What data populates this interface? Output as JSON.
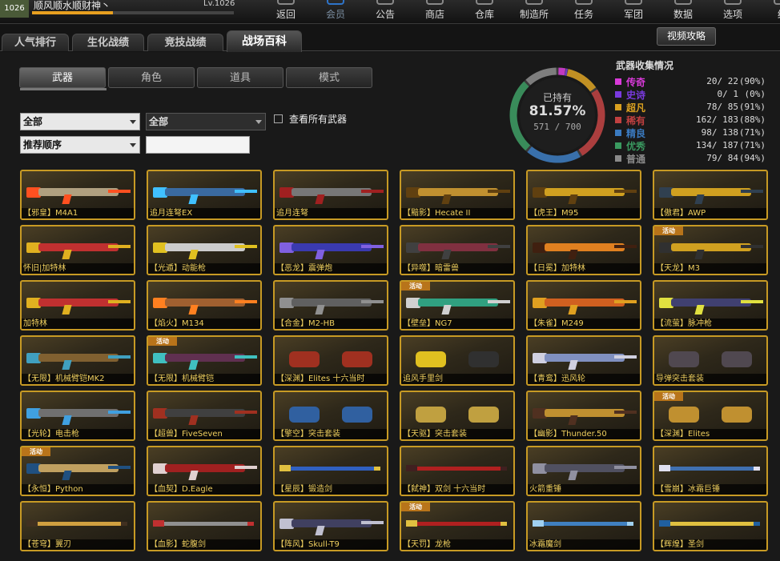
{
  "player": {
    "level_badge": "1026",
    "name": "顺风顺水顺财神丶",
    "level_text": "Lv.1026",
    "exp_fraction": 0.4
  },
  "menu": [
    {
      "label": "返回",
      "icon": "back-arrow-icon"
    },
    {
      "label": "会员",
      "icon": "vip-icon",
      "active": true
    },
    {
      "label": "公告",
      "icon": "megaphone-icon"
    },
    {
      "label": "商店",
      "icon": "shop-icon"
    },
    {
      "label": "仓库",
      "icon": "warehouse-icon"
    },
    {
      "label": "制造所",
      "icon": "factory-icon"
    },
    {
      "label": "任务",
      "icon": "task-icon"
    },
    {
      "label": "军团",
      "icon": "clan-icon"
    },
    {
      "label": "数据",
      "icon": "data-icon"
    },
    {
      "label": "选项",
      "icon": "options-icon"
    },
    {
      "label": "结",
      "icon": "exit-icon"
    }
  ],
  "tabs": [
    {
      "label": "人气排行"
    },
    {
      "label": "生化战绩"
    },
    {
      "label": "竞技战绩"
    },
    {
      "label": "战场百科",
      "active": true
    }
  ],
  "video_button": "视频攻略",
  "subtabs": [
    {
      "label": "武器",
      "active": true
    },
    {
      "label": "角色"
    },
    {
      "label": "道具"
    },
    {
      "label": "模式"
    }
  ],
  "filters": {
    "category": "全部",
    "subcategory": "全部",
    "sort": "推荐顺序",
    "search_value": "",
    "show_all_label": "查看所有武器",
    "show_all_checked": false
  },
  "collection": {
    "title": "武器收集情况",
    "owned_label": "已持有",
    "percent": "81.57%",
    "ratio": "571 / 700",
    "rows": [
      {
        "name": "传奇",
        "count": "20/  22",
        "pct": "(90%)",
        "color": "#d93ad9",
        "owned": 20,
        "total": 22
      },
      {
        "name": "史诗",
        "count": "0/   1",
        "pct": "(0%)",
        "color": "#7a3ae0",
        "owned": 0,
        "total": 1
      },
      {
        "name": "超凡",
        "count": "78/  85",
        "pct": "(91%)",
        "color": "#d9a020",
        "owned": 78,
        "total": 85
      },
      {
        "name": "稀有",
        "count": "162/ 183",
        "pct": "(88%)",
        "color": "#c04040",
        "owned": 162,
        "total": 183
      },
      {
        "name": "精良",
        "count": "98/ 138",
        "pct": "(71%)",
        "color": "#3a7ac0",
        "owned": 98,
        "total": 138
      },
      {
        "name": "优秀",
        "count": "134/ 187",
        "pct": "(71%)",
        "color": "#3a9a60",
        "owned": 134,
        "total": 187
      },
      {
        "name": "普通",
        "count": "79/  84",
        "pct": "(94%)",
        "color": "#8a8a8a",
        "owned": 79,
        "total": 84
      }
    ]
  },
  "weapons": [
    {
      "label": "【邪皇】M4A1",
      "kind": "rifle",
      "c1": "#b0a080",
      "c2": "#ff5020"
    },
    {
      "label": "追月连弩EX",
      "kind": "rifle",
      "c1": "#3a6aa0",
      "c2": "#40c0ff"
    },
    {
      "label": "追月连弩",
      "kind": "rifle",
      "c1": "#777777",
      "c2": "#a02020"
    },
    {
      "label": "【黯影】Hecate II",
      "kind": "rifle",
      "c1": "#c09030",
      "c2": "#604010"
    },
    {
      "label": "【虎王】M95",
      "kind": "rifle",
      "c1": "#d0a020",
      "c2": "#604010"
    },
    {
      "label": "【傲君】AWP",
      "kind": "rifle",
      "c1": "#d0a020",
      "c2": "#304050"
    },
    {
      "label": "怀旧|加特林",
      "kind": "heavy",
      "c1": "#c03030",
      "c2": "#e0b020"
    },
    {
      "label": "【光遁】动能枪",
      "kind": "rifle",
      "c1": "#cccccc",
      "c2": "#e0c020"
    },
    {
      "label": "【恶龙】震弹炮",
      "kind": "heavy",
      "c1": "#3a3ab0",
      "c2": "#8060e0"
    },
    {
      "label": "【异噬】暗雷兽",
      "kind": "heavy",
      "c1": "#803040",
      "c2": "#404040"
    },
    {
      "label": "【日冕】加特林",
      "kind": "heavy",
      "c1": "#e08020",
      "c2": "#402010"
    },
    {
      "label": "【天龙】M3",
      "kind": "rifle",
      "c1": "#d0a020",
      "c2": "#303030",
      "badge": "活动"
    },
    {
      "label": "加特林",
      "kind": "heavy",
      "c1": "#c03030",
      "c2": "#e0b020"
    },
    {
      "label": "【焰火】M134",
      "kind": "heavy",
      "c1": "#a06030",
      "c2": "#ff8020"
    },
    {
      "label": "【合金】M2-HB",
      "kind": "rifle",
      "c1": "#606060",
      "c2": "#909090"
    },
    {
      "label": "【壁垒】NG7",
      "kind": "rifle",
      "c1": "#30a080",
      "c2": "#d0d0d0",
      "badge": "活动"
    },
    {
      "label": "【朱雀】M249",
      "kind": "heavy",
      "c1": "#d06020",
      "c2": "#e0a020"
    },
    {
      "label": "【流萤】脉冲枪",
      "kind": "rifle",
      "c1": "#404070",
      "c2": "#e0e040"
    },
    {
      "label": "【无限】机械臂铠MK2",
      "kind": "heavy",
      "c1": "#806030",
      "c2": "#40a0c0"
    },
    {
      "label": "【无限】机械臂铠",
      "kind": "heavy",
      "c1": "#603050",
      "c2": "#40c0c0",
      "badge": "活动"
    },
    {
      "label": "【深渊】Elites 十六当时",
      "kind": "pair",
      "c1": "#a03020",
      "c2": "#a03020"
    },
    {
      "label": "追风手里剑",
      "kind": "pair",
      "c1": "#e0c020",
      "c2": "#303030"
    },
    {
      "label": "【青鸾】迅风轮",
      "kind": "heavy",
      "c1": "#8090c0",
      "c2": "#d0d0e0"
    },
    {
      "label": "导弹突击套装",
      "kind": "pair",
      "c1": "#504850",
      "c2": "#504850"
    },
    {
      "label": "【光轮】电击枪",
      "kind": "pistol",
      "c1": "#707070",
      "c2": "#40a0e0"
    },
    {
      "label": "【超兽】FiveSeven",
      "kind": "pistol",
      "c1": "#404040",
      "c2": "#a03020"
    },
    {
      "label": "【擎空】突击套装",
      "kind": "pair",
      "c1": "#3060a0",
      "c2": "#3060a0"
    },
    {
      "label": "【天驱】突击套装",
      "kind": "pair",
      "c1": "#c0a040",
      "c2": "#c0a040"
    },
    {
      "label": "【幽影】Thunder.50",
      "kind": "rifle",
      "c1": "#c09030",
      "c2": "#503020"
    },
    {
      "label": "【深渊】Elites",
      "kind": "pair",
      "c1": "#c09030",
      "c2": "#c09030",
      "badge": "活动"
    },
    {
      "label": "【永恒】Python",
      "kind": "pistol",
      "c1": "#c0a060",
      "c2": "#205080",
      "badge": "活动"
    },
    {
      "label": "【血契】D.Eagle",
      "kind": "pistol",
      "c1": "#a02020",
      "c2": "#e0d0d0"
    },
    {
      "label": "【星辰】锻造剑",
      "kind": "blade",
      "c1": "#3060c0",
      "c2": "#e0c040"
    },
    {
      "label": "【弑神】双剑 十六当时",
      "kind": "blade",
      "c1": "#b02020",
      "c2": "#402020"
    },
    {
      "label": "火箭重锤",
      "kind": "heavy",
      "c1": "#505060",
      "c2": "#9090a0"
    },
    {
      "label": "【雪崩】冰霜巨锤",
      "kind": "blade",
      "c1": "#4070b0",
      "c2": "#e0e0f0"
    },
    {
      "label": "【苍穹】翼刃",
      "kind": "blade",
      "c1": "#d0a040",
      "c2": "#403020"
    },
    {
      "label": "【血影】蛇腹剑",
      "kind": "blade",
      "c1": "#909090",
      "c2": "#c03030"
    },
    {
      "label": "【阵风】Skull-T9",
      "kind": "heavy",
      "c1": "#404060",
      "c2": "#c0c0d0"
    },
    {
      "label": "【天罚】龙枪",
      "kind": "blade",
      "c1": "#b02020",
      "c2": "#e0c040",
      "badge": "活动"
    },
    {
      "label": "冰霜魔剑",
      "kind": "blade",
      "c1": "#4080c0",
      "c2": "#a0d0f0"
    },
    {
      "label": "【辉煌】圣剑",
      "kind": "blade",
      "c1": "#e0c040",
      "c2": "#2060a0"
    }
  ]
}
